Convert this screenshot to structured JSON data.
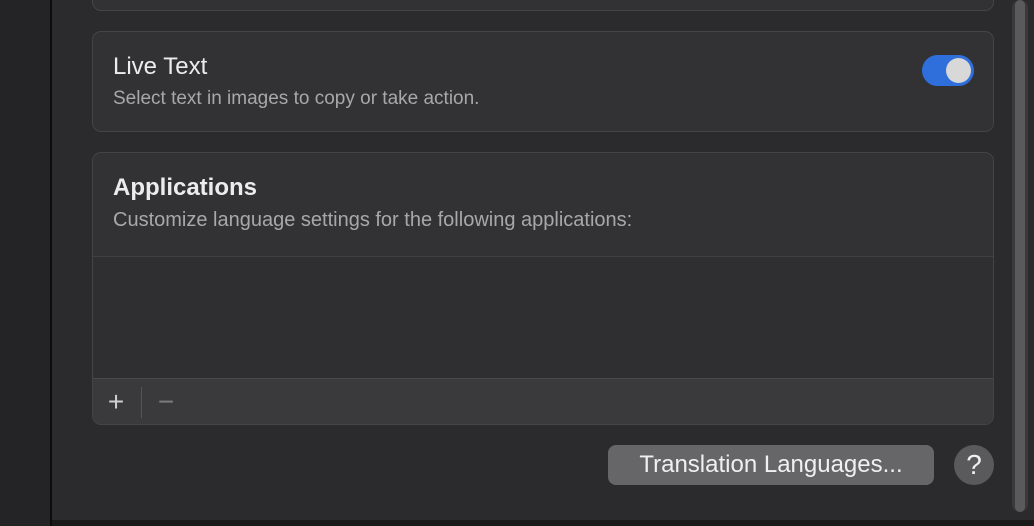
{
  "live_text": {
    "title": "Live Text",
    "description": "Select text in images to copy or take action.",
    "enabled": true,
    "toggle_color": "#2f6fdc"
  },
  "applications": {
    "title": "Applications",
    "description": "Customize language settings for the following applications:",
    "items": [],
    "add_glyph": "+",
    "remove_glyph": "−"
  },
  "footer": {
    "translation_button_label": "Translation Languages...",
    "help_glyph": "?"
  },
  "icons": [
    "plus-icon",
    "minus-icon",
    "question-mark-icon"
  ]
}
